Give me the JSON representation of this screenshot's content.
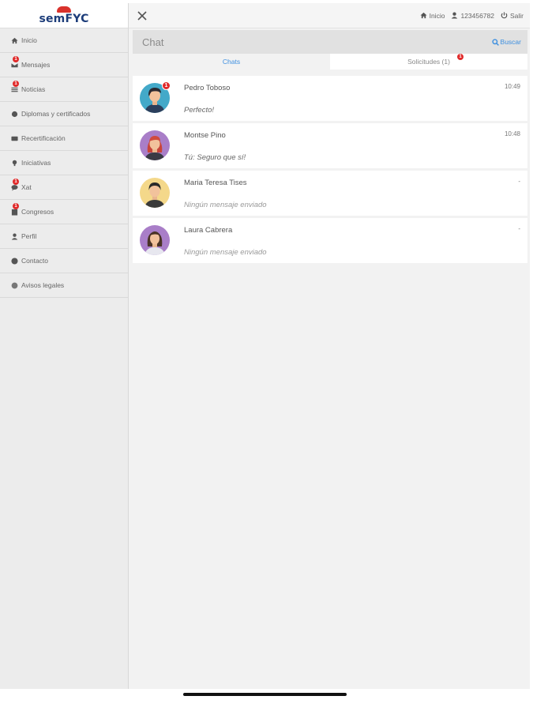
{
  "app": {
    "logo_text": "semFYC",
    "brand_color": "#1d3d7a",
    "accent_color": "#d9322c"
  },
  "sidebar": {
    "items": [
      {
        "label": "Inicio",
        "icon": "home-icon",
        "badge": ""
      },
      {
        "label": "Mensajes",
        "icon": "envelope-icon",
        "badge": "1"
      },
      {
        "label": "Noticias",
        "icon": "news-icon",
        "badge": "1"
      },
      {
        "label": "Diplomas y certificados",
        "icon": "certificate-icon",
        "badge": ""
      },
      {
        "label": "Recertificación",
        "icon": "id-card-icon",
        "badge": ""
      },
      {
        "label": "Iniciativas",
        "icon": "lightbulb-icon",
        "badge": ""
      },
      {
        "label": "Xat",
        "icon": "chat-bubble-icon",
        "badge": "1"
      },
      {
        "label": "Congresos",
        "icon": "building-icon",
        "badge": "1"
      },
      {
        "label": "Perfil",
        "icon": "user-icon",
        "badge": ""
      },
      {
        "label": "Contacto",
        "icon": "info-icon",
        "badge": ""
      },
      {
        "label": "Avisos legales",
        "icon": "legal-icon",
        "badge": ""
      }
    ]
  },
  "topbar": {
    "home_label": "Inicio",
    "user_label": "123456782",
    "logout_label": "Salir"
  },
  "chat": {
    "title": "Chat",
    "search_label": "Buscar",
    "tabs": {
      "chats": "Chats",
      "requests": "Solicitudes (1)",
      "requests_badge": "1"
    },
    "items": [
      {
        "name": "Pedro Toboso",
        "time": "10:49",
        "message": "Perfecto!",
        "badge": "1",
        "avatar": "male-avatar-icon"
      },
      {
        "name": "Montse Pino",
        "time": "10:48",
        "message": "Tú: Seguro que sí!",
        "badge": "",
        "avatar": "female-redhair-avatar-icon"
      },
      {
        "name": "Maria Teresa Tises",
        "time": "-",
        "message": "Ningún mensaje enviado",
        "badge": "",
        "avatar": "male-darkhair-avatar-icon"
      },
      {
        "name": "Laura Cabrera",
        "time": "-",
        "message": "Ningún mensaje enviado",
        "badge": "",
        "avatar": "female-avatar-icon"
      }
    ]
  }
}
